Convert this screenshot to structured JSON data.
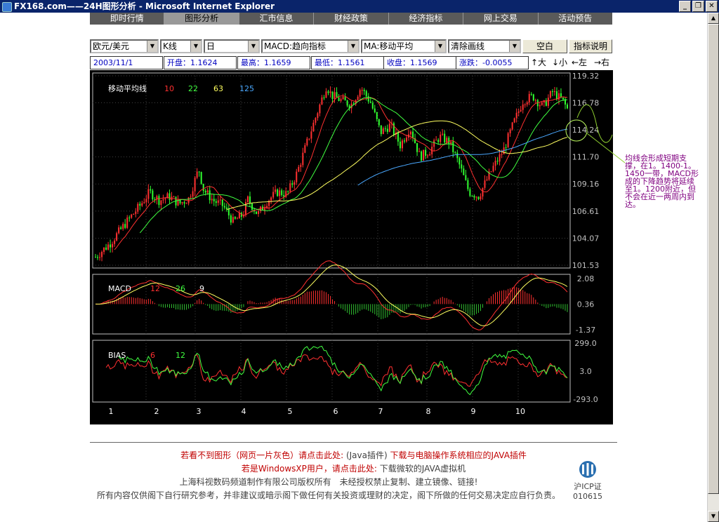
{
  "window": {
    "title": "FX168.com——24H图形分析 - Microsoft Internet Explorer"
  },
  "nav": {
    "items": [
      "即时行情",
      "图形分析",
      "汇市信息",
      "财经政策",
      "经济指标",
      "网上交易",
      "活动预告"
    ]
  },
  "toolbar": {
    "pair": "欧元/美元",
    "chart_type": "K线",
    "period": "日",
    "indicator1": "MACD:趋向指标",
    "indicator2": "MA:移动平均",
    "drawing": "清除画线",
    "blank_button": "空白",
    "help_button": "指标说明"
  },
  "info": {
    "date": "2003/11/1",
    "open": "开盘：1.1624",
    "high": "最高：1.1659",
    "low": "最低：1.1561",
    "close": "收盘：1.1569",
    "change": "涨跌：-0.0055"
  },
  "zoom": {
    "bigger": "↑大",
    "smaller": "↓小",
    "left": "←左",
    "right": "→右"
  },
  "chart_data": {
    "type": "line",
    "main": {
      "label": "移动平均线",
      "ma_periods": [
        "10",
        "22",
        "63",
        "125"
      ],
      "ma_colors": [
        "#ff3030",
        "#40ff40",
        "#ffff60",
        "#4aa8ff"
      ],
      "y_ticks": [
        "119.32",
        "116.78",
        "114.24",
        "111.70",
        "109.16",
        "106.61",
        "104.07",
        "101.53"
      ],
      "price_path": [
        [
          0,
          102.3
        ],
        [
          3,
          103.6
        ],
        [
          6,
          105.4
        ],
        [
          9,
          107.1
        ],
        [
          11,
          108.4
        ],
        [
          13,
          107.6
        ],
        [
          15,
          108.0
        ],
        [
          17,
          107.3
        ],
        [
          19,
          107.8
        ],
        [
          21,
          110.6
        ],
        [
          22,
          108.6
        ],
        [
          24,
          107.6
        ],
        [
          26,
          107.1
        ],
        [
          28,
          105.6
        ],
        [
          30,
          106.3
        ],
        [
          31,
          107.7
        ],
        [
          33,
          106.3
        ],
        [
          35,
          107.6
        ],
        [
          37,
          108.4
        ],
        [
          39,
          108.2
        ],
        [
          41,
          110.2
        ],
        [
          43,
          113.0
        ],
        [
          45,
          115.7
        ],
        [
          47,
          118.4
        ],
        [
          48,
          117.5
        ],
        [
          50,
          117.0
        ],
        [
          52,
          116.6
        ],
        [
          54,
          118.2
        ],
        [
          56,
          116.8
        ],
        [
          58,
          114.0
        ],
        [
          60,
          114.7
        ],
        [
          62,
          112.8
        ],
        [
          64,
          114.5
        ],
        [
          66,
          111.7
        ],
        [
          68,
          112.3
        ],
        [
          70,
          113.6
        ],
        [
          72,
          113.1
        ],
        [
          74,
          111.0
        ],
        [
          76,
          108.4
        ],
        [
          78,
          108.0
        ],
        [
          79,
          109.0
        ],
        [
          81,
          110.8
        ],
        [
          83,
          112.3
        ],
        [
          85,
          114.8
        ],
        [
          87,
          117.0
        ],
        [
          89,
          117.4
        ],
        [
          91,
          116.4
        ],
        [
          93,
          117.8
        ],
        [
          95,
          117.0
        ],
        [
          96,
          116.2
        ]
      ]
    },
    "macd": {
      "label": "MACD",
      "params": [
        "12",
        "26",
        "9"
      ],
      "y_ticks": [
        "2.08",
        "0.36",
        "-1.37"
      ]
    },
    "bias": {
      "label": "BIAS",
      "params": [
        "6",
        "12"
      ],
      "y_ticks": [
        "299.0",
        "3.0",
        "-293.0"
      ]
    },
    "x_ticks": [
      "1",
      "2",
      "3",
      "4",
      "5",
      "6",
      "7",
      "8",
      "9",
      "10"
    ]
  },
  "annotation": "均线会形成短期支撑，在1。1400-1。1450一带，MACD形成的下降趋势将延续至1。1200附近，但不会在近一两周内到达。",
  "footer": {
    "line1_red": "若看不到图形（网页一片灰色）请点击此处:",
    "line1_gray": "(Java插件)",
    "line1_link": "下载与电脑操作系统相应的JAVA插件",
    "line2_red": "若是WindowsXP用户，请点击此处:",
    "line2_link": "下载微软的JAVA虚拟机",
    "copyright": "上海科视数码频道制作有限公司版权所有　未经授权禁止复制、建立镜像、链接!",
    "disclaimer": "所有内容仅供阁下自行研究参考，并非建议或暗示阁下做任何有关投资或理财的决定，阁下所做的任何交易决定应自行负责。",
    "icp_label": "沪ICP证",
    "icp_number": "010615"
  }
}
